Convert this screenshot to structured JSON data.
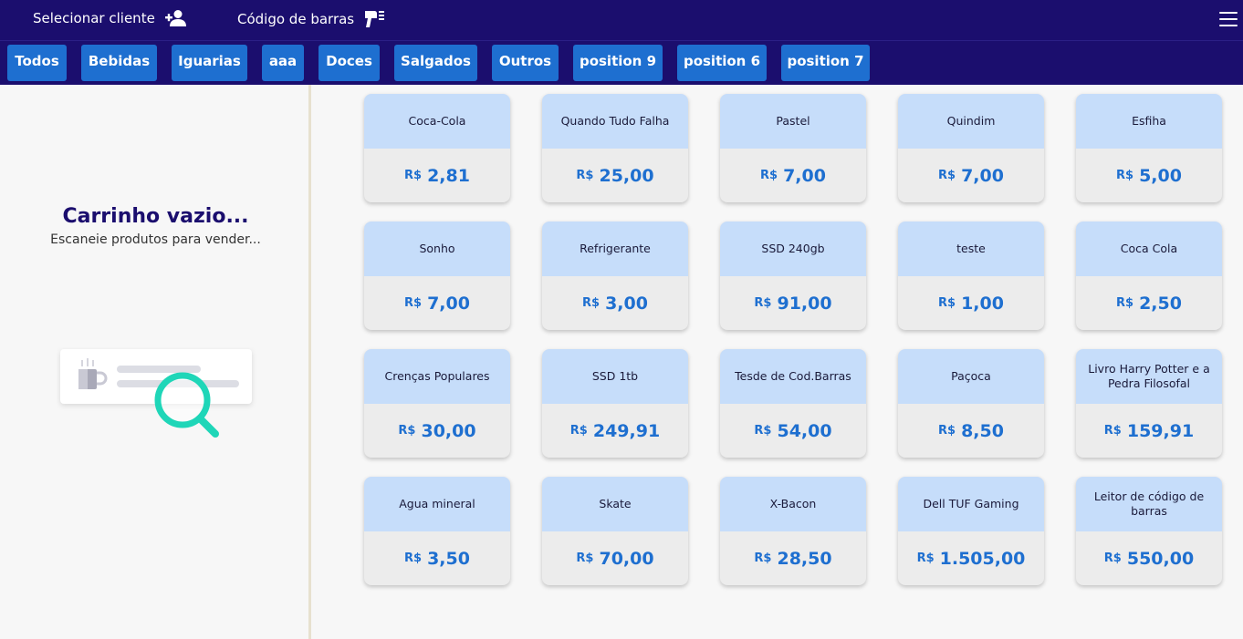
{
  "header": {
    "select_client_label": "Selecionar cliente",
    "barcode_label": "Código de barras",
    "icons": {
      "client": "add-user-icon",
      "barcode": "barcode-scanner-icon",
      "menu": "hamburger-menu-icon"
    }
  },
  "categories": [
    "Todos",
    "Bebidas",
    "Iguarias",
    "aaa",
    "Doces",
    "Salgados",
    "Outros",
    "position 9",
    "position 6",
    "position 7"
  ],
  "cart": {
    "title": "Carrinho vazio...",
    "subtitle": "Escaneie produtos para vender..."
  },
  "currency": "R$",
  "products": [
    {
      "name": "Coca-Cola",
      "price": "2,81"
    },
    {
      "name": "Quando Tudo Falha",
      "price": "25,00"
    },
    {
      "name": "Pastel",
      "price": "7,00"
    },
    {
      "name": "Quindim",
      "price": "7,00"
    },
    {
      "name": "Esfiha",
      "price": "5,00"
    },
    {
      "name": "Sonho",
      "price": "7,00"
    },
    {
      "name": "Refrigerante",
      "price": "3,00"
    },
    {
      "name": "SSD 240gb",
      "price": "91,00"
    },
    {
      "name": "teste",
      "price": "1,00"
    },
    {
      "name": "Coca Cola",
      "price": "2,50"
    },
    {
      "name": "Crenças Populares",
      "price": "30,00"
    },
    {
      "name": "SSD 1tb",
      "price": "249,91"
    },
    {
      "name": "Tesde de Cod.Barras",
      "price": "54,00"
    },
    {
      "name": "Paçoca",
      "price": "8,50"
    },
    {
      "name": "Livro Harry Potter e a Pedra Filosofal",
      "price": "159,91"
    },
    {
      "name": "Agua mineral",
      "price": "3,50"
    },
    {
      "name": "Skate",
      "price": "70,00"
    },
    {
      "name": "X-Bacon",
      "price": "28,50"
    },
    {
      "name": "Dell TUF Gaming",
      "price": "1.505,00"
    },
    {
      "name": "Leitor de código de barras",
      "price": "550,00"
    }
  ],
  "colors": {
    "header_bg": "#1b0e6e",
    "category_bg": "#1e6fd0",
    "card_top": "#c6ddfa",
    "price_text": "#1e6fd0",
    "illustration_accent": "#1fd6b8"
  }
}
